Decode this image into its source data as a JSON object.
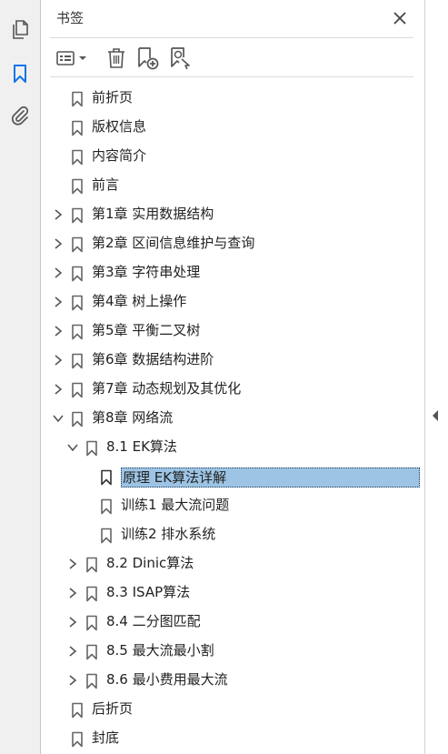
{
  "rail": {
    "pages_icon": "copy-pages-icon",
    "bookmarks_icon": "bookmark-icon",
    "attachments_icon": "paperclip-icon"
  },
  "panel": {
    "title": "书签",
    "close_icon": "close-icon"
  },
  "toolbar": {
    "options_icon": "options-menu-icon",
    "delete_icon": "trash-icon",
    "new_bookmark_icon": "add-bookmark-icon",
    "find_bookmark_icon": "find-bookmark-icon"
  },
  "bookmarks": [
    {
      "label": "前折页",
      "level": 0,
      "expand": "none"
    },
    {
      "label": "版权信息",
      "level": 0,
      "expand": "none"
    },
    {
      "label": "内容简介",
      "level": 0,
      "expand": "none"
    },
    {
      "label": "前言",
      "level": 0,
      "expand": "none"
    },
    {
      "label": "第1章 实用数据结构",
      "level": 0,
      "expand": "collapsed"
    },
    {
      "label": "第2章 区间信息维护与查询",
      "level": 0,
      "expand": "collapsed"
    },
    {
      "label": "第3章 字符串处理",
      "level": 0,
      "expand": "collapsed"
    },
    {
      "label": "第4章 树上操作",
      "level": 0,
      "expand": "collapsed"
    },
    {
      "label": "第5章 平衡二叉树",
      "level": 0,
      "expand": "collapsed"
    },
    {
      "label": "第6章 数据结构进阶",
      "level": 0,
      "expand": "collapsed"
    },
    {
      "label": "第7章 动态规划及其优化",
      "level": 0,
      "expand": "collapsed"
    },
    {
      "label": "第8章 网络流",
      "level": 0,
      "expand": "expanded"
    },
    {
      "label": "8.1 EK算法",
      "level": 1,
      "expand": "expanded"
    },
    {
      "label": "原理 EK算法详解",
      "level": 2,
      "expand": "none",
      "selected": true
    },
    {
      "label": "训练1 最大流问题",
      "level": 2,
      "expand": "none"
    },
    {
      "label": "训练2 排水系统",
      "level": 2,
      "expand": "none"
    },
    {
      "label": "8.2 Dinic算法",
      "level": 1,
      "expand": "collapsed"
    },
    {
      "label": "8.3 ISAP算法",
      "level": 1,
      "expand": "collapsed"
    },
    {
      "label": "8.4 二分图匹配",
      "level": 1,
      "expand": "collapsed"
    },
    {
      "label": "8.5 最大流最小割",
      "level": 1,
      "expand": "collapsed"
    },
    {
      "label": "8.6 最小费用最大流",
      "level": 1,
      "expand": "collapsed"
    },
    {
      "label": "后折页",
      "level": 0,
      "expand": "none"
    },
    {
      "label": "封底",
      "level": 0,
      "expand": "none"
    }
  ],
  "splitter": {
    "arrow_icon": "collapse-left-arrow-icon"
  },
  "colors": {
    "accent": "#1473e6",
    "selection": "#9dc4e4",
    "icon": "#555555"
  }
}
